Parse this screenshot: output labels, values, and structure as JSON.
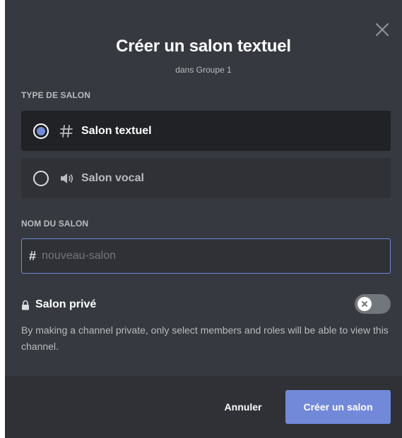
{
  "modal": {
    "title": "Créer un salon textuel",
    "subtitle": "dans Groupe 1",
    "close_icon": "close-icon"
  },
  "channel_type": {
    "label": "TYPE DE SALON",
    "options": [
      {
        "label": "Salon textuel",
        "icon": "hash-icon",
        "selected": true
      },
      {
        "label": "Salon vocal",
        "icon": "speaker-icon",
        "selected": false
      }
    ]
  },
  "channel_name": {
    "label": "NOM DU SALON",
    "prefix": "#",
    "value": "",
    "placeholder": "nouveau-salon"
  },
  "private": {
    "label": "Salon privé",
    "icon": "lock-icon",
    "enabled": false,
    "description": "By making a channel private, only select members and roles will be able to view this channel."
  },
  "footer": {
    "cancel_label": "Annuler",
    "create_label": "Créer un salon"
  },
  "colors": {
    "background": "#36393f",
    "footer": "#2f3136",
    "selected_option": "#202225",
    "accent": "#7289da",
    "toggle_off": "#72767d"
  }
}
